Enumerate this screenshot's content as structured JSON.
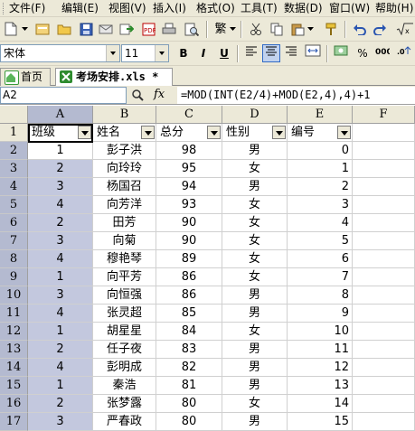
{
  "menu": [
    "文件(F)",
    "编辑(E)",
    "视图(V)",
    "插入(I)",
    "格式(O)",
    "工具(T)",
    "数据(D)",
    "窗口(W)",
    "帮助(H)"
  ],
  "toolbar2": {
    "font": "宋体",
    "size": "11",
    "bold": "B",
    "italic": "I",
    "underline": "U"
  },
  "tabs": {
    "home": "首页",
    "doc": "考场安排.xls *"
  },
  "formula_bar": {
    "cell": "A2",
    "fx": "fx",
    "formula": "=MOD(INT(E2/4)+MOD(E2,4),4)+1"
  },
  "columns": [
    "A",
    "B",
    "C",
    "D",
    "E",
    "F"
  ],
  "headers": [
    "班级",
    "姓名",
    "总分",
    "性别",
    "编号"
  ],
  "rows": [
    [
      "1",
      "彭子洪",
      "98",
      "男",
      "0"
    ],
    [
      "2",
      "向玲玲",
      "95",
      "女",
      "1"
    ],
    [
      "3",
      "杨国召",
      "94",
      "男",
      "2"
    ],
    [
      "4",
      "向芳洋",
      "93",
      "女",
      "3"
    ],
    [
      "2",
      "田芳",
      "90",
      "女",
      "4"
    ],
    [
      "3",
      "向菊",
      "90",
      "女",
      "5"
    ],
    [
      "4",
      "穆艳琴",
      "89",
      "女",
      "6"
    ],
    [
      "1",
      "向平芳",
      "86",
      "女",
      "7"
    ],
    [
      "3",
      "向恒强",
      "86",
      "男",
      "8"
    ],
    [
      "4",
      "张灵超",
      "85",
      "男",
      "9"
    ],
    [
      "1",
      "胡星星",
      "84",
      "女",
      "10"
    ],
    [
      "2",
      "任子夜",
      "83",
      "男",
      "11"
    ],
    [
      "4",
      "彭明成",
      "82",
      "男",
      "12"
    ],
    [
      "1",
      "秦浩",
      "81",
      "男",
      "13"
    ],
    [
      "2",
      "张梦露",
      "80",
      "女",
      "14"
    ],
    [
      "3",
      "严春政",
      "80",
      "男",
      "15"
    ]
  ],
  "row_numbers": [
    "1",
    "2",
    "3",
    "4",
    "5",
    "6",
    "7",
    "8",
    "9",
    "10",
    "11",
    "12",
    "13",
    "14",
    "15",
    "16",
    "17"
  ]
}
